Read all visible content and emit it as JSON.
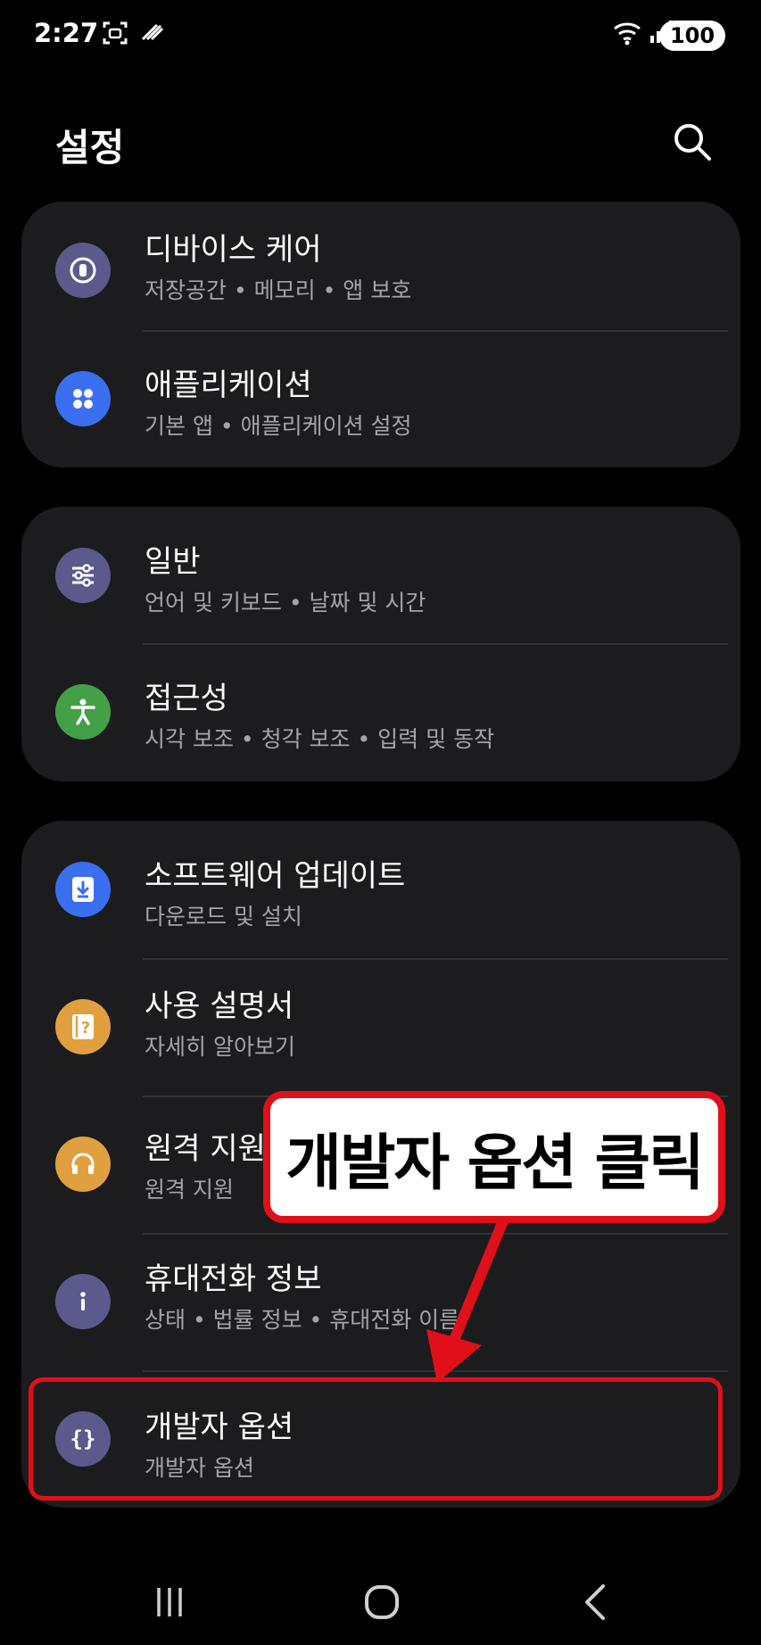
{
  "status_bar": {
    "time": "2:27",
    "battery": "100"
  },
  "header": {
    "title": "설정"
  },
  "sections": [
    {
      "items": [
        {
          "title": "디바이스 케어",
          "subtitle": "저장공간 • 메모리 • 앱 보호",
          "icon": "device-care-icon",
          "color": "#5c5a8c"
        },
        {
          "title": "애플리케이션",
          "subtitle": "기본 앱 • 애플리케이션 설정",
          "icon": "apps-grid-icon",
          "color": "#3a6ff0"
        }
      ]
    },
    {
      "items": [
        {
          "title": "일반",
          "subtitle": "언어 및 키보드 • 날짜 및 시간",
          "icon": "sliders-icon",
          "color": "#5c5a8c"
        },
        {
          "title": "접근성",
          "subtitle": "시각 보조 • 청각 보조 • 입력 및 동작",
          "icon": "accessibility-icon",
          "color": "#43a047"
        }
      ]
    },
    {
      "items": [
        {
          "title": "소프트웨어 업데이트",
          "subtitle": "다운로드 및 설치",
          "icon": "download-icon",
          "color": "#3a6ff0"
        },
        {
          "title": "사용 설명서",
          "subtitle": "자세히 알아보기",
          "icon": "manual-icon",
          "color": "#e0a040"
        },
        {
          "title": "원격 지원",
          "subtitle": "원격 지원",
          "icon": "headset-icon",
          "color": "#e0a040"
        },
        {
          "title": "휴대전화 정보",
          "subtitle": "상태 • 법률 정보 • 휴대전화 이름",
          "icon": "info-icon",
          "color": "#5c5a8c"
        },
        {
          "title": "개발자 옵션",
          "subtitle": "개발자 옵션",
          "icon": "braces-icon",
          "color": "#5c5a8c"
        }
      ]
    }
  ],
  "annotation": {
    "callout": "개발자 옵션 클릭",
    "color": "#e0101a"
  }
}
